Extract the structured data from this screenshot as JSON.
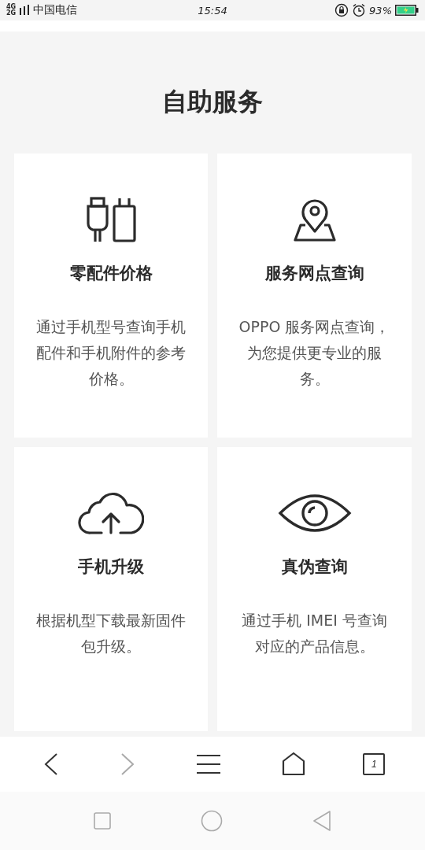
{
  "status_bar": {
    "network_top": "4G",
    "network_bottom": "2G",
    "carrier": "中国电信",
    "time": "15:54",
    "battery_percent": "93%"
  },
  "title": "自助服务",
  "cards": [
    {
      "kind": "charger",
      "title": "零配件价格",
      "description": "通过手机型号查询手机配件和手机附件的参考价格。"
    },
    {
      "kind": "map-pin",
      "title": "服务网点查询",
      "description": "OPPO 服务网点查询，为您提供更专业的服务。"
    },
    {
      "kind": "cloud-upload",
      "title": "手机升级",
      "description": "根据机型下载最新固件包升级。"
    },
    {
      "kind": "eye",
      "title": "真伪查询",
      "description": "通过手机 IMEI 号查询对应的产品信息。"
    }
  ],
  "toolbar": {
    "back_disabled": false,
    "forward_disabled": true,
    "tab_count": "1"
  }
}
